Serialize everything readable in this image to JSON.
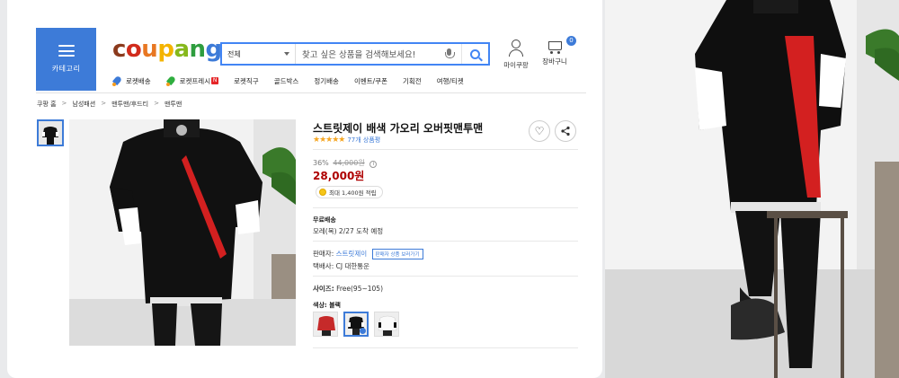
{
  "header": {
    "category_label": "카테고리",
    "logo_letters": [
      {
        "ch": "c",
        "color": "#8b3a1c"
      },
      {
        "ch": "o",
        "color": "#d12c1c"
      },
      {
        "ch": "u",
        "color": "#e87722"
      },
      {
        "ch": "p",
        "color": "#f4b400"
      },
      {
        "ch": "a",
        "color": "#86b81c"
      },
      {
        "ch": "n",
        "color": "#2e9d3e"
      },
      {
        "ch": "g",
        "color": "#3d7bd8"
      }
    ],
    "search": {
      "category": "전체",
      "placeholder": "찾고 싶은 상품을 검색해보세요!"
    },
    "my_coupang": "마이쿠팡",
    "cart": "장바구니",
    "cart_count": "0"
  },
  "subnav": {
    "items": [
      {
        "label": "로켓배송",
        "icon": "rocket-blue-icon"
      },
      {
        "label": "로켓프레시",
        "icon": "rocket-green-icon",
        "new": "N"
      },
      {
        "label": "로켓직구"
      },
      {
        "label": "골드박스"
      },
      {
        "label": "정기배송"
      },
      {
        "label": "이벤트/쿠폰"
      },
      {
        "label": "기획전"
      },
      {
        "label": "여행/티켓"
      }
    ]
  },
  "breadcrumb": [
    "쿠팡 홈",
    "남성패션",
    "맨투맨/후드티",
    "맨투맨"
  ],
  "product": {
    "title": "스트릿제이 배색 가오리 오버핏맨투맨",
    "stars": "★★★★★",
    "reviews": "77개 상품평",
    "discount": "36%",
    "original_price": "44,000원",
    "info_icon": "i",
    "price": "28,000원",
    "reward": "최대 1,400원 적립",
    "shipping_label": "무료배송",
    "delivery": "모레(목) 2/27 도착 예정",
    "seller_label": "판매자:",
    "seller_name": "스트릿제이",
    "seller_more": "판매자 상품 보러가기",
    "courier": "택배사: CJ 대한통운",
    "size_label": "사이즈:",
    "size_value": "Free(95~105)",
    "color_label": "색상: 블랙",
    "heart_glyph": "♡",
    "share_glyph": "⋖"
  },
  "colors": {
    "accent": "#3d7bd8",
    "price": "#ae0000"
  }
}
